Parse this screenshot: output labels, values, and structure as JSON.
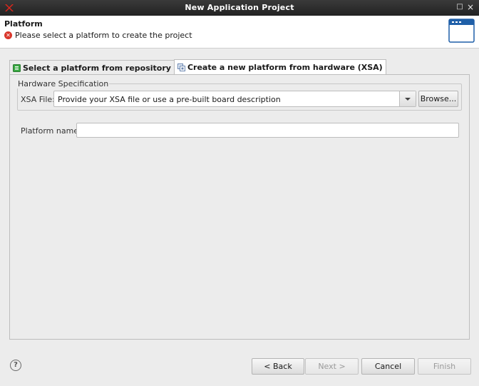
{
  "window": {
    "title": "New Application Project",
    "app_icon": "xilinx-logo-icon",
    "controls": {
      "maximize": "□",
      "close": "×"
    }
  },
  "header": {
    "title": "Platform",
    "message": "Please select a platform to create the project",
    "message_icon": "error-icon",
    "wizard_icon": "window-icon"
  },
  "tabs": [
    {
      "label": "Select a platform from repository",
      "icon": "repository-icon",
      "active": false
    },
    {
      "label": "Create a new platform from hardware (XSA)",
      "icon": "hardware-icon",
      "active": true
    }
  ],
  "hardware": {
    "group_label": "Hardware Specification",
    "xsa_label": "XSA File:",
    "xsa_value": "Provide your XSA file or use a pre-built board description",
    "browse_label": "Browse..."
  },
  "platform": {
    "name_label": "Platform name:",
    "name_value": ""
  },
  "footer": {
    "help": "?",
    "back": "< Back",
    "next": "Next >",
    "cancel": "Cancel",
    "finish": "Finish"
  },
  "colors": {
    "title_bar": "#2b2b2b",
    "error": "#d9362b",
    "accent_blue": "#1f5fa8"
  }
}
